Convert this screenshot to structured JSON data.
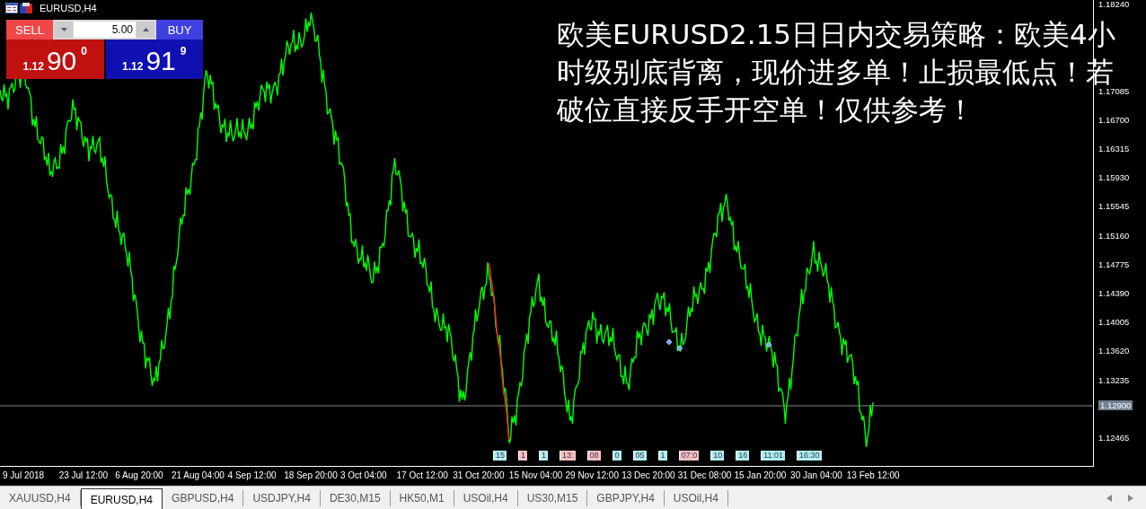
{
  "chart": {
    "title": "EURUSD,H4",
    "trade_panel": {
      "sell_label": "SELL",
      "buy_label": "BUY",
      "volume": "5.00",
      "sell_price": {
        "prefix": "1.12",
        "big": "90",
        "sup": "0"
      },
      "buy_price": {
        "prefix": "1.12",
        "big": "91",
        "sup": "9"
      }
    },
    "overlay_text": [
      "欧美EURUSD2.15日日内交易策略：欧美4小",
      "时级别底背离，现价进多单！止损最低点！若",
      "破位直接反手开空单！仅供参考！"
    ],
    "price_axis": [
      "1.18240",
      "1.17085",
      "1.16700",
      "1.16315",
      "1.15930",
      "1.15545",
      "1.15160",
      "1.14775",
      "1.14390",
      "1.14005",
      "1.13620",
      "1.13235",
      "1.12465"
    ],
    "current_price": "1.12900",
    "time_axis": [
      "9 Jul 2018",
      "23 Jul 12:00",
      "6 Aug 20:00",
      "21 Aug 04:00",
      "4 Sep 12:00",
      "18 Sep 20:00",
      "3 Oct 04:00",
      "17 Oct 12:00",
      "31 Oct 20:00",
      "15 Nov 04:00",
      "29 Nov 12:00",
      "13 Dec 20:00",
      "31 Dec 08:00",
      "15 Jan 20:00",
      "30 Jan 04:00",
      "13 Feb 12:00"
    ],
    "events": [
      {
        "label": "15",
        "color": "#b0f0f0"
      },
      {
        "label": "1",
        "color": "#ffc0c0"
      },
      {
        "label": "1",
        "color": "#b0f0f0"
      },
      {
        "label": "13:",
        "color": "#ffc0c0"
      },
      {
        "label": "08",
        "color": "#ffc0c0"
      },
      {
        "label": "0",
        "color": "#b0f0f0"
      },
      {
        "label": "05",
        "color": "#b0f0f0"
      },
      {
        "label": "1",
        "color": "#b0f0f0"
      },
      {
        "label": "07:0",
        "color": "#ffc0c0"
      },
      {
        "label": "10",
        "color": "#b0f0f0"
      },
      {
        "label": "16",
        "color": "#b0f0f0"
      },
      {
        "label": "11:01",
        "color": "#b0f0f0"
      },
      {
        "label": "16:30",
        "color": "#b0f0f0"
      }
    ]
  },
  "tabs": [
    {
      "label": "XAUUSD,H4",
      "selected": false
    },
    {
      "label": "EURUSD,H4",
      "selected": true
    },
    {
      "label": "GBPUSD,H4",
      "selected": false
    },
    {
      "label": "USDJPY,H4",
      "selected": false
    },
    {
      "label": "DE30,M15",
      "selected": false
    },
    {
      "label": "HK50,M1",
      "selected": false
    },
    {
      "label": "USOil,H4",
      "selected": false
    },
    {
      "label": "US30,M15",
      "selected": false
    },
    {
      "label": "GBPJPY,H4",
      "selected": false
    },
    {
      "label": "USOil,H4",
      "selected": false
    }
  ]
}
